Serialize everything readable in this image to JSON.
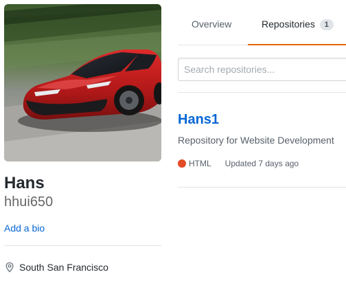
{
  "profile": {
    "avatar_icon": "car-photo-avatar",
    "fullname": "Hans",
    "username": "hhui650",
    "add_bio_label": "Add a bio",
    "location": "South San Francisco",
    "location_icon": "location-pin-icon"
  },
  "tabs": [
    {
      "label": "Overview",
      "active": false
    },
    {
      "label": "Repositories",
      "count": "1",
      "active": true
    }
  ],
  "search": {
    "placeholder": "Search repositories..."
  },
  "repos": [
    {
      "name": "Hans1",
      "description": "Repository for Website Development",
      "language": "HTML",
      "language_color": "#e34c26",
      "updated": "Updated 7 days ago"
    }
  ],
  "colors": {
    "link": "#0366d6",
    "tab_underline": "#e36209",
    "border": "#e1e4e8"
  }
}
